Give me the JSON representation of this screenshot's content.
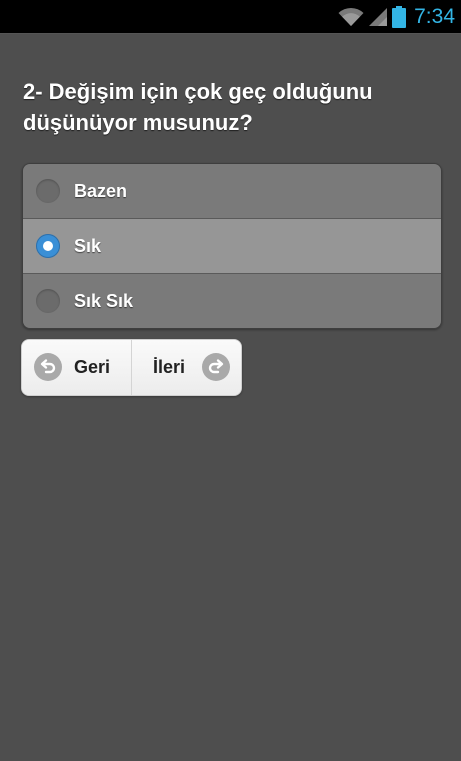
{
  "status_bar": {
    "time": "7:34",
    "accent_color": "#33b5e5",
    "icons": [
      "wifi-icon",
      "signal-icon",
      "battery-icon"
    ]
  },
  "question": {
    "text": "2- Değişim için çok geç olduğunu düşünüyor musunuz?"
  },
  "options": [
    {
      "label": "Bazen",
      "selected": false
    },
    {
      "label": "Sık",
      "selected": true
    },
    {
      "label": "Sık Sık",
      "selected": false
    }
  ],
  "navigation": {
    "back_label": "Geri",
    "next_label": "İleri",
    "back_icon": "undo-arrow-icon",
    "next_icon": "redo-arrow-icon"
  },
  "colors": {
    "background": "#4e4e4e",
    "radio_checked": "#3a8fd6"
  }
}
